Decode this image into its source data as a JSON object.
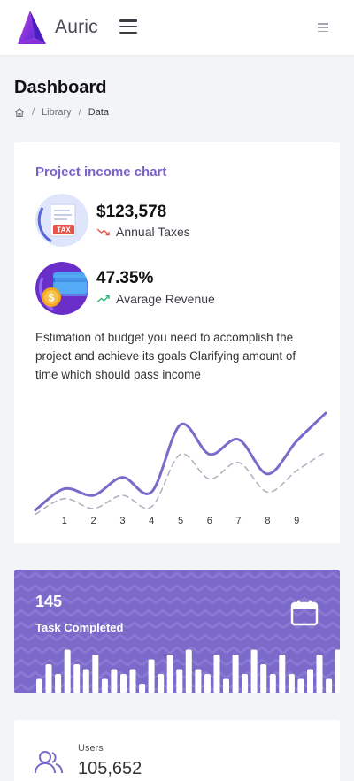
{
  "header": {
    "brand_name": "Auric"
  },
  "page": {
    "title": "Dashboard",
    "breadcrumb": [
      "Library",
      "Data"
    ]
  },
  "income_card": {
    "title": "Project income chart",
    "stats": [
      {
        "value": "$123,578",
        "label": "Annual Taxes",
        "trend": "down",
        "icon": "tax-document-icon",
        "badge": "TAX"
      },
      {
        "value": "47.35%",
        "label": "Avarage Revenue",
        "trend": "up",
        "icon": "revenue-card-icon"
      }
    ],
    "description": "Estimation of budget you need to accomplish the project and achieve its goals Clarifying amount of time which should pass income"
  },
  "chart_data": {
    "type": "line",
    "x": [
      0,
      1,
      2,
      3,
      4,
      5,
      6,
      7,
      8,
      9,
      10
    ],
    "tick_labels": [
      "1",
      "2",
      "3",
      "4",
      "5",
      "6",
      "7",
      "8",
      "9"
    ],
    "series": [
      {
        "values": [
          1,
          3.6,
          2.8,
          5,
          3.2,
          11.4,
          7.8,
          9.6,
          5.4,
          9.4,
          12.8
        ],
        "style": "solid",
        "color": "#7b6ac9"
      },
      {
        "values": [
          0.5,
          2.4,
          1.2,
          2.8,
          1.4,
          7.8,
          4.8,
          6.8,
          3.2,
          5.8,
          8.1
        ],
        "style": "dashed",
        "color": "#b0b4c2"
      }
    ],
    "ylim": [
      0,
      14
    ],
    "grid": false,
    "legend": "none"
  },
  "task_card": {
    "value": "145",
    "label": "Task Completed",
    "bars": [
      3,
      6,
      4,
      9,
      6,
      5,
      8,
      3,
      5,
      4,
      5,
      2,
      7,
      4,
      8,
      5,
      9,
      5,
      4,
      8,
      3,
      8,
      4,
      9,
      6,
      4,
      8,
      4,
      3,
      5,
      8,
      3,
      9
    ],
    "color": "#7b6ac9"
  },
  "users_card": {
    "label": "Users",
    "value": "105,652"
  },
  "colors": {
    "accent": "#7b6ac9",
    "title_accent": "#7a62c9",
    "trend_down": "#e5534b",
    "trend_up": "#2fb57a"
  }
}
